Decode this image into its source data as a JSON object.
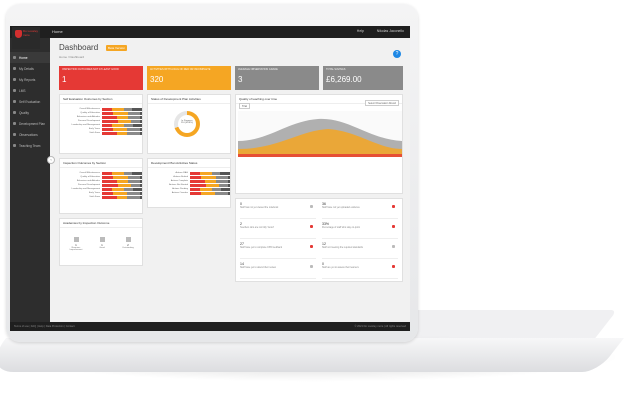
{
  "header": {
    "app_name": "Do Loosley more",
    "nav_home": "Home",
    "help_label": "Help",
    "user_label": "Nikolas Jaconello"
  },
  "sidebar": {
    "items": [
      {
        "label": "Home"
      },
      {
        "label": "My Details"
      },
      {
        "label": "My Reports"
      },
      {
        "label": "LMS"
      },
      {
        "label": "Self Evaluation"
      },
      {
        "label": "Quality"
      },
      {
        "label": "Development Plan"
      },
      {
        "label": "Observations"
      },
      {
        "label": "Teaching Team"
      }
    ]
  },
  "page": {
    "title": "Dashboard",
    "badge": "Beta Version",
    "breadcrumb": "Home / Dashboard"
  },
  "kpis": [
    {
      "title": "Inspection outcomes not at least good",
      "value": "1",
      "color": "#e53935"
    },
    {
      "title": "Activities with a rag of red or incomplete",
      "value": "320",
      "color": "#f5a623"
    },
    {
      "title": "Average observation grade",
      "value": "3",
      "color": "#8a8a8a"
    },
    {
      "title": "Total savings",
      "value": "£6,269.00",
      "color": "#8a8a8a"
    }
  ],
  "cards": {
    "self_eval": {
      "title": "Self Evaluation Outcomes by Section",
      "rows": [
        "Overall Effectiveness",
        "Quality of Education",
        "Behaviour and Attitudes",
        "Personal Development",
        "Leadership and Management",
        "Early Years",
        "Sixth Form"
      ]
    },
    "dev_status": {
      "title": "Status of Development Plan Activities",
      "center_value": "In Progress",
      "center_sub": "210 (65.8%)"
    },
    "quality_time": {
      "title": "Quality of teaching over time",
      "dropdown": "Select Observation Round",
      "tab": "Trial"
    },
    "inspection": {
      "title": "Inspection Outcomes by Section",
      "rows": [
        "Overall Effectiveness",
        "Quality of Education",
        "Behaviour and Attitudes",
        "Personal Development",
        "Leadership and Management",
        "Early Years",
        "Sixth Form"
      ]
    },
    "dev_actions": {
      "title": "Development Plan Activities Status",
      "rows": [
        "Actions RAG",
        "Actions Behind",
        "Actions Complete",
        "Actions Not Started",
        "Actions Pending",
        "Actions Overdue"
      ]
    },
    "academy": {
      "title": "Academies by Inspection Outcome",
      "items": [
        {
          "value": "1",
          "label": "Requires Improvement"
        },
        {
          "value": "1",
          "label": "Good"
        },
        {
          "value": "2",
          "label": "Outstanding"
        }
      ]
    }
  },
  "stats_left": [
    {
      "value": "0",
      "desc": "Staff has not yet viewed the notebook",
      "color": "#bbbbbb"
    },
    {
      "value": "2",
      "desc": "Teachers who are not fully 'Good'",
      "color": "#e53935"
    },
    {
      "value": "27",
      "desc": "Staff have yet to complete CPD feedback",
      "color": "#e53935"
    },
    {
      "value": "14",
      "desc": "Staff have yet to attend their review",
      "color": "#bbbbbb"
    }
  ],
  "stats_right": [
    {
      "value": "36",
      "desc": "Staff have not yet uploaded evidence",
      "color": "#e53935"
    },
    {
      "value": "33%",
      "desc": "Percentage of staff who stay on-point",
      "color": "#e53935"
    },
    {
      "value": "12",
      "desc": "Staff not meeting the required standards",
      "color": "#bbbbbb"
    },
    {
      "value": "0",
      "desc": "Staff are yet to assess their learners",
      "color": "#e53935"
    }
  ],
  "footer": {
    "left": "Terms of use  |  FAQ  |  Help   |   Data Protection  |  Contact",
    "right": "© 2021 Do Loosley more  |  All rights reserved"
  }
}
